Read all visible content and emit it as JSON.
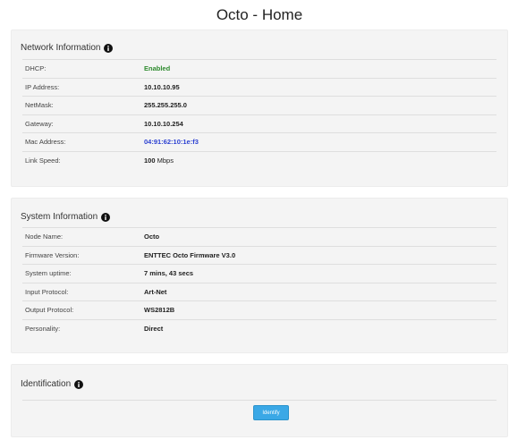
{
  "page": {
    "title": "Octo - Home"
  },
  "network": {
    "title": "Network Information",
    "rows": [
      {
        "label": "DHCP:",
        "value": "Enabled"
      },
      {
        "label": "IP Address:",
        "value": "10.10.10.95"
      },
      {
        "label": "NetMask:",
        "value": "255.255.255.0"
      },
      {
        "label": "Gateway:",
        "value": "10.10.10.254"
      },
      {
        "label": "Mac Address:",
        "value": "04:91:62:10:1e:f3"
      },
      {
        "label": "Link Speed:",
        "value": "100",
        "unit": "Mbps"
      }
    ]
  },
  "system": {
    "title": "System Information",
    "rows": [
      {
        "label": "Node Name:",
        "value": "Octo"
      },
      {
        "label": "Firmware Version:",
        "value": "ENTTEC Octo Firmware V3.0"
      },
      {
        "label": "System uptime:",
        "value": "7 mins, 43 secs"
      },
      {
        "label": "Input Protocol:",
        "value": "Art-Net"
      },
      {
        "label": "Output Protocol:",
        "value": "WS2812B"
      },
      {
        "label": "Personality:",
        "value": "Direct"
      }
    ]
  },
  "identification": {
    "title": "Identification",
    "button_label": "Identify"
  },
  "colors": {
    "enabled": "#2e8b2e",
    "mac": "#2a3fd1",
    "button": "#3aa8e6"
  },
  "icons": {
    "info": "info-circle-icon"
  }
}
